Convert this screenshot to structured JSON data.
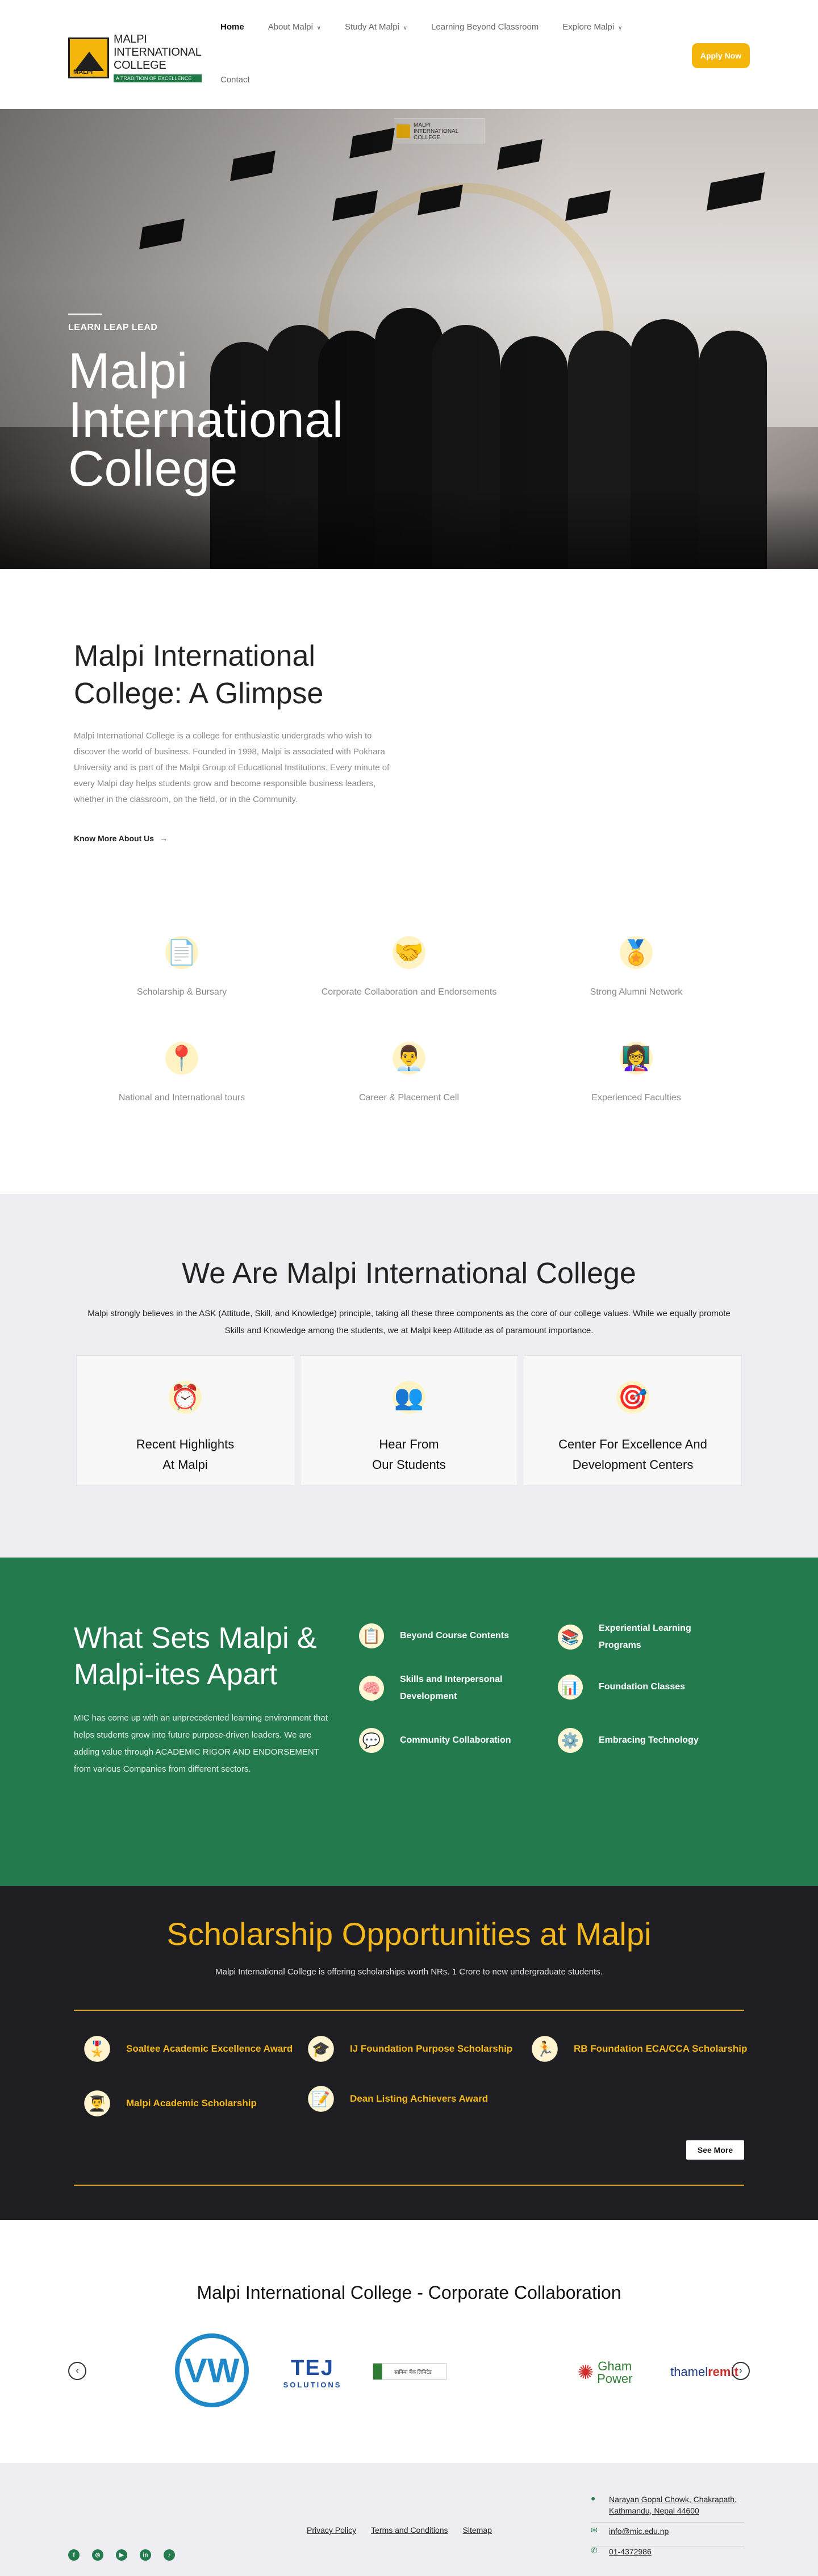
{
  "header": {
    "logo_lines": [
      "MALPI",
      "INTERNATIONAL",
      "COLLEGE"
    ],
    "logo_tagline": "A TRADITION OF EXCELLENCE",
    "nav": [
      {
        "label": "Home",
        "active": true,
        "dropdown": false
      },
      {
        "label": "About Malpi",
        "active": false,
        "dropdown": true
      },
      {
        "label": "Study At Malpi",
        "active": false,
        "dropdown": true
      },
      {
        "label": "Learning Beyond Classroom",
        "active": false,
        "dropdown": false
      },
      {
        "label": "Explore Malpi",
        "active": false,
        "dropdown": true
      }
    ],
    "nav_second_row": "Contact",
    "apply_label": "Apply Now",
    "accent": "#f5b60c"
  },
  "hero": {
    "kicker": "LEARN LEAP LEAD",
    "title": "Malpi International College"
  },
  "glimpse": {
    "title": "Malpi International College: A Glimpse",
    "body": "Malpi International College is a college for enthusiastic undergrads who wish to discover the world of business. Founded in 1998, Malpi is associated with Pokhara University and is part of the Malpi Group of Educational Institutions. Every minute of every Malpi day helps students grow and become responsible business leaders, whether in the classroom, on the field, or in the Community.",
    "link": "Know More About Us",
    "link_arrow": "→"
  },
  "features": [
    {
      "label": "Scholarship & Bursary",
      "icon": "scholarship-icon",
      "glyph": "📄"
    },
    {
      "label": "Corporate Collaboration and Endorsements",
      "icon": "collaboration-icon",
      "glyph": "🤝"
    },
    {
      "label": "Strong Alumni Network",
      "icon": "alumni-icon",
      "glyph": "🏅"
    },
    {
      "label": "National and International tours",
      "icon": "tours-icon",
      "glyph": "📍"
    },
    {
      "label": "Career & Placement Cell",
      "icon": "career-icon",
      "glyph": "👨‍💼"
    },
    {
      "label": "Experienced Faculties",
      "icon": "faculty-icon",
      "glyph": "👩‍🏫"
    }
  ],
  "weare": {
    "title": "We Are Malpi International College",
    "body": "Malpi strongly believes in the ASK (Attitude, Skill, and Knowledge) principle, taking all these three components as the core of our college values. While we equally promote Skills and Knowledge among the students, we at Malpi keep Attitude as of paramount importance.",
    "cards": [
      {
        "label": "Recent Highlights\nAt Malpi",
        "icon": "clock-icon",
        "glyph": "⏰"
      },
      {
        "label": "Hear From\nOur Students",
        "icon": "students-icon",
        "glyph": "👥"
      },
      {
        "label": "Center For Excellence And\nDevelopment Centers",
        "icon": "excellence-icon",
        "glyph": "🎯"
      }
    ]
  },
  "sets": {
    "title": "What Sets Malpi & Malpi-ites Apart",
    "body": "MIC has come up with an unprecedented learning environment that helps students grow into future purpose-driven leaders. We are adding value through ACADEMIC RIGOR AND ENDORSEMENT from various Companies from different sectors.",
    "items": [
      {
        "label": "Beyond Course Contents",
        "icon": "checklist-icon",
        "glyph": "📋"
      },
      {
        "label": "Experiential Learning Programs",
        "icon": "learning-icon",
        "glyph": "📚"
      },
      {
        "label": "Skills and Interpersonal Development",
        "icon": "skills-icon",
        "glyph": "🧠"
      },
      {
        "label": "Foundation Classes",
        "icon": "foundation-icon",
        "glyph": "📊"
      },
      {
        "label": "Community Collaboration",
        "icon": "community-icon",
        "glyph": "💬"
      },
      {
        "label": "Embracing Technology",
        "icon": "technology-icon",
        "glyph": "⚙️"
      }
    ],
    "bg": "#237a4d"
  },
  "scholarship": {
    "title": "Scholarship Opportunities at Malpi",
    "subtitle": "Malpi International College is offering scholarships worth NRs. 1 Crore to new undergraduate students.",
    "items": [
      {
        "label": "Soaltee Academic Excellence Award",
        "icon": "award-icon",
        "glyph": "🎖️"
      },
      {
        "label": "IJ Foundation Purpose Scholarship",
        "icon": "graduation-cap-icon",
        "glyph": "🎓"
      },
      {
        "label": "RB Foundation ECA/CCA Scholarship",
        "icon": "sports-icon",
        "glyph": "🏃"
      },
      {
        "label": "Malpi Academic Scholarship",
        "icon": "scholar-icon",
        "glyph": "👨‍🎓"
      },
      {
        "label": "Dean Listing Achievers Award",
        "icon": "list-icon",
        "glyph": "📝"
      }
    ],
    "see_more": "See More",
    "accent": "#f5b81b"
  },
  "partners": {
    "title": "Malpi International College - Corporate Collaboration",
    "logos": [
      {
        "name": "Volkswagen",
        "text": "VW"
      },
      {
        "name": "Tej Solutions",
        "text": "TEJ",
        "sub": "SOLUTIONS"
      },
      {
        "name": "Bank logo",
        "text": ""
      },
      {
        "name": "Gham Power",
        "text": "Gham",
        "sub": "Power"
      },
      {
        "name": "Thamel Remit",
        "text": "thamel",
        "accent": "remit"
      }
    ],
    "prev": "‹",
    "next": "›"
  },
  "footer": {
    "links": [
      "Privacy Policy",
      "Terms and Conditions",
      "Sitemap"
    ],
    "address": "Narayan Gopal Chowk, Chakrapath, Kathmandu, Nepal 44600",
    "email": "info@mic.edu.np",
    "phone": "01-4372986",
    "social": [
      "facebook-icon",
      "instagram-icon",
      "youtube-icon",
      "linkedin-icon",
      "tiktok-icon"
    ]
  }
}
